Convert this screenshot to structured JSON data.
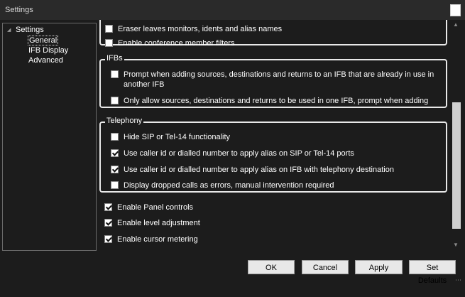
{
  "window": {
    "title": "Settings"
  },
  "tree": {
    "root": "Settings",
    "children": [
      "General",
      "IFB Display",
      "Advanced"
    ],
    "selected": "General"
  },
  "top_options": [
    {
      "label": "Eraser leaves monitors, idents and alias names",
      "checked": false
    },
    {
      "label": "Enable conference member filters",
      "checked": false
    }
  ],
  "ifbs": {
    "title": "IFBs",
    "options": [
      {
        "label": "Prompt when adding sources, destinations and returns to an IFB that are already in use in another IFB",
        "line1": "Prompt when adding sources, destinations and returns to an IFB that are already in use in",
        "line2": "another IFB",
        "checked": false
      },
      {
        "label": "Only allow sources, destinations and returns to be used in one IFB, prompt when adding",
        "checked": false
      }
    ]
  },
  "telephony": {
    "title": "Telephony",
    "options": [
      {
        "label": "Hide SIP or Tel-14 functionality",
        "checked": false
      },
      {
        "label": "Use caller id or dialled number to apply alias on SIP or Tel-14 ports",
        "checked": true
      },
      {
        "label": "Use caller id or dialled number to apply alias on IFB with telephony destination",
        "checked": true
      },
      {
        "label": "Display dropped calls as errors, manual intervention required",
        "checked": false
      }
    ]
  },
  "bottom_options": [
    {
      "label": "Enable Panel controls",
      "checked": true
    },
    {
      "label": "Enable level adjustment",
      "checked": true
    },
    {
      "label": "Enable cursor metering",
      "checked": true
    }
  ],
  "buttons": {
    "ok": "OK",
    "cancel": "Cancel",
    "apply": "Apply",
    "set_defaults": "Set Defaults"
  }
}
